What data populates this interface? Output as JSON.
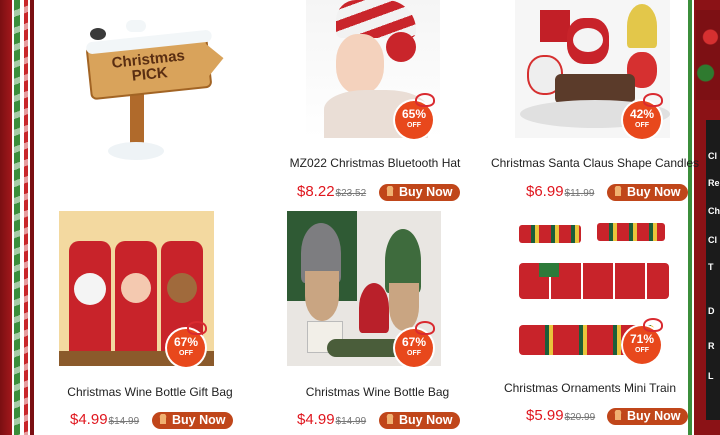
{
  "hero": {
    "sign_line1": "Christmas",
    "sign_line2": "PICK"
  },
  "products": [
    {
      "title": "MZ022 Christmas Bluetooth Hat",
      "price": "$8.22",
      "old_price": "$23.52",
      "discount": "65%",
      "off": "OFF",
      "buy": "Buy Now"
    },
    {
      "title": "Christmas Santa Claus Shape Candles",
      "price": "$6.99",
      "old_price": "$11.99",
      "discount": "42%",
      "off": "OFF",
      "buy": "Buy Now"
    },
    {
      "title": "Christmas Wine Bottle Gift Bag",
      "price": "$4.99",
      "old_price": "$14.99",
      "discount": "67%",
      "off": "OFF",
      "buy": "Buy Now"
    },
    {
      "title": "Christmas Wine Bottle Bag",
      "price": "$4.99",
      "old_price": "$14.99",
      "discount": "67%",
      "off": "OFF",
      "buy": "Buy Now"
    },
    {
      "title": "Christmas Ornaments Mini Train",
      "price": "$5.99",
      "old_price": "$20.99",
      "discount": "71%",
      "off": "OFF",
      "buy": "Buy Now"
    }
  ],
  "side_nav": [
    "Cl",
    "Re",
    "Ch",
    "Cl",
    "T",
    "",
    "D",
    "",
    "R",
    "L"
  ],
  "colors": {
    "price": "#e0161e",
    "buy_button": "#c0461a",
    "badge": "#e8481c",
    "border_red": "#8b1216",
    "border_green": "#3b8e3b"
  }
}
